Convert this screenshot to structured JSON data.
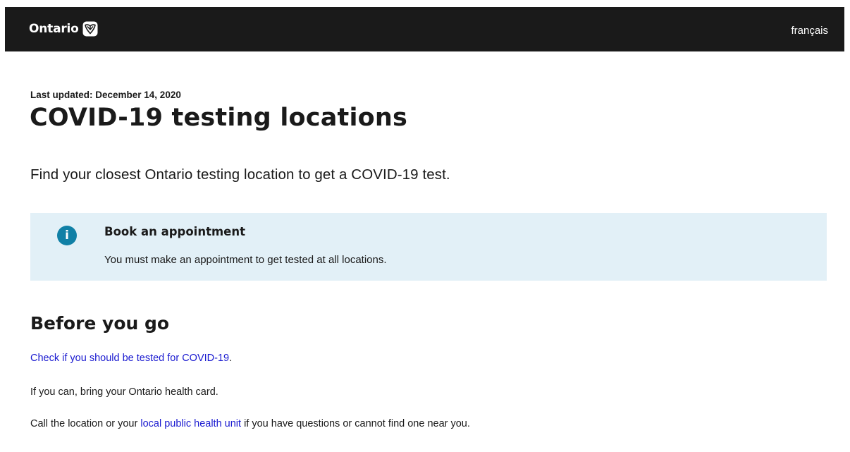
{
  "header": {
    "logo_text": "Ontario",
    "logo_icon": "ontario-trillium-icon",
    "language_link": "français",
    "background": "#1a1a1a"
  },
  "main": {
    "last_updated": "Last updated: December 14, 2020",
    "title": "COVID-19 testing locations",
    "lead": "Find your closest Ontario testing location to get a COVID-19 test."
  },
  "callout": {
    "icon": "info-icon",
    "icon_glyph": "i",
    "title": "Book an appointment",
    "body": "You must make an appointment to get tested at all locations.",
    "background": "#e2f0f7",
    "icon_color": "#1080a6"
  },
  "before_you_go": {
    "heading": "Before you go",
    "check_link": "Check if you should be tested for COVID-19",
    "check_suffix": ".",
    "health_card": "If you can, bring your Ontario health card.",
    "call_prefix": "Call the location or your ",
    "call_link": "local public health unit",
    "call_suffix": " if you have questions or cannot find one near you.",
    "link_color": "#1a1ad0"
  }
}
